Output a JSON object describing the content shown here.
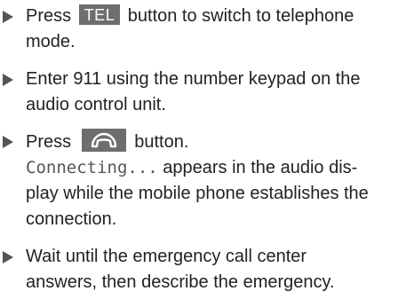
{
  "steps": [
    {
      "before": "Press",
      "button_label": "TEL",
      "after_line1": "button to switch to telephone",
      "line2": "mode."
    },
    {
      "line1": "Enter 911 using the number keypad on the",
      "line2": "audio control unit."
    },
    {
      "before": "Press",
      "button_icon": "phone-handset-icon",
      "after": "button."
    },
    {
      "status_text": "Connecting...",
      "after_line1": "appears in the audio dis-",
      "line2": "play while the mobile phone establishes the",
      "line3": "connection."
    },
    {
      "line1": "Wait until the emergency call center",
      "line2": "answers, then describe the emergency."
    }
  ]
}
